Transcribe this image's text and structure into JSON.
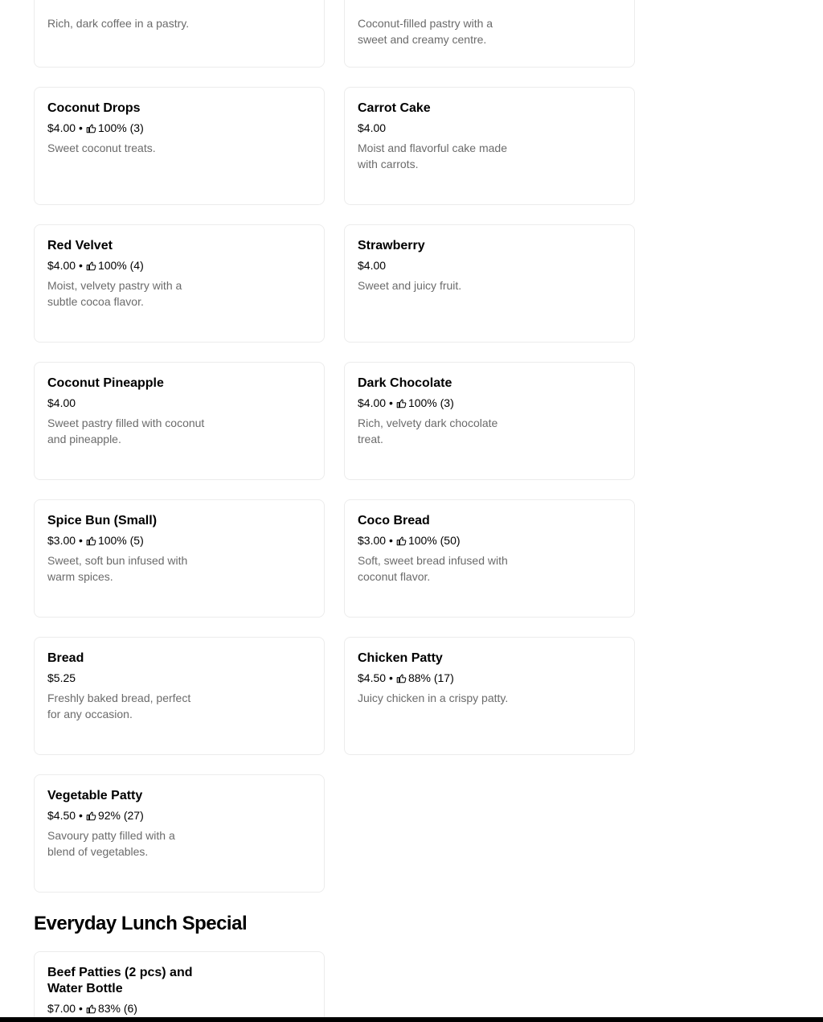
{
  "menu": {
    "cards": [
      {
        "name": "",
        "price": "",
        "rating": "",
        "desc": "Rich, dark coffee in a pastry."
      },
      {
        "name": "",
        "price": "",
        "rating": "",
        "desc": "Coconut-filled pastry with a sweet and creamy centre."
      },
      {
        "name": "Coconut Drops",
        "price": "$4.00",
        "rating": "100% (3)",
        "desc": "Sweet coconut treats."
      },
      {
        "name": "Carrot Cake",
        "price": "$4.00",
        "rating": "",
        "desc": "Moist and flavorful cake made with carrots."
      },
      {
        "name": "Red Velvet",
        "price": "$4.00",
        "rating": "100% (4)",
        "desc": "Moist, velvety pastry with a subtle cocoa flavor."
      },
      {
        "name": "Strawberry",
        "price": "$4.00",
        "rating": "",
        "desc": "Sweet and juicy fruit."
      },
      {
        "name": "Coconut Pineapple",
        "price": "$4.00",
        "rating": "",
        "desc": "Sweet pastry filled with coconut and pineapple."
      },
      {
        "name": "Dark Chocolate",
        "price": "$4.00",
        "rating": "100% (3)",
        "desc": "Rich, velvety dark chocolate treat."
      },
      {
        "name": "Spice Bun (Small)",
        "price": "$3.00",
        "rating": "100% (5)",
        "desc": "Sweet, soft bun infused with warm spices."
      },
      {
        "name": "Coco Bread",
        "price": "$3.00",
        "rating": "100% (50)",
        "desc": "Soft, sweet bread infused with coconut flavor."
      },
      {
        "name": "Bread",
        "price": "$5.25",
        "rating": "",
        "desc": "Freshly baked bread, perfect for any occasion."
      },
      {
        "name": "Chicken Patty",
        "price": "$4.50",
        "rating": "88% (17)",
        "desc": "Juicy chicken in a crispy patty."
      },
      {
        "name": "Vegetable Patty",
        "price": "$4.50",
        "rating": "92% (27)",
        "desc": "Savoury patty filled with a blend of vegetables."
      }
    ]
  },
  "lunch": {
    "section_title": "Everyday Lunch Special",
    "cards": [
      {
        "name": "Beef Patties (2 pcs) and Water Bottle",
        "price": "$7.00",
        "rating": "83% (6)",
        "desc": ""
      }
    ]
  },
  "icons": {
    "rating": "thumbs-up-icon"
  },
  "colors": {
    "card_border": "#ececec",
    "description_text": "#6b6b6b",
    "text": "#000000"
  }
}
